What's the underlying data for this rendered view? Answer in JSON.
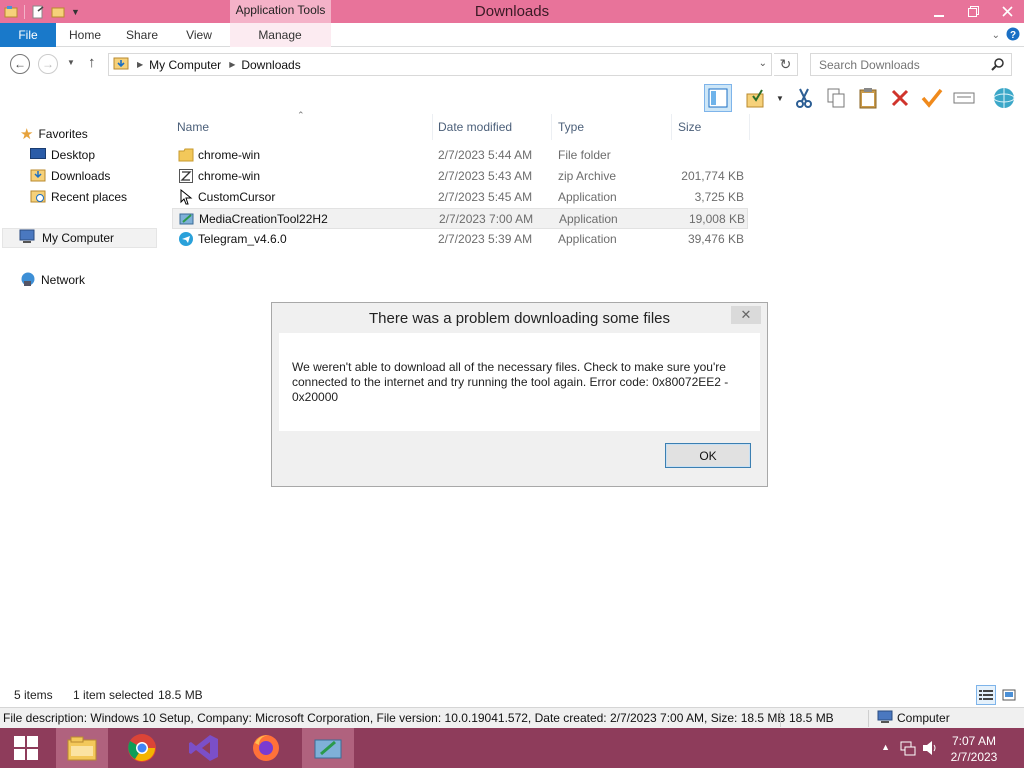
{
  "window": {
    "title": "Downloads",
    "context_tab": "Application Tools"
  },
  "ribbon": {
    "tabs": [
      "File",
      "Home",
      "Share",
      "View",
      "Manage"
    ]
  },
  "address": {
    "crumbs": [
      "My Computer",
      "Downloads"
    ],
    "search_placeholder": "Search Downloads"
  },
  "nav": {
    "favorites": "Favorites",
    "desktop": "Desktop",
    "downloads": "Downloads",
    "recent": "Recent places",
    "computer": "My Computer",
    "network": "Network"
  },
  "columns": {
    "name": "Name",
    "date": "Date modified",
    "type": "Type",
    "size": "Size"
  },
  "files": [
    {
      "name": "chrome-win",
      "date": "2/7/2023 5:44 AM",
      "type": "File folder",
      "size": "",
      "icon": "folder-icon"
    },
    {
      "name": "chrome-win",
      "date": "2/7/2023 5:43 AM",
      "type": "zip Archive",
      "size": "201,774 KB",
      "icon": "zip-icon"
    },
    {
      "name": "CustomCursor",
      "date": "2/7/2023 5:45 AM",
      "type": "Application",
      "size": "3,725 KB",
      "icon": "cursor-icon"
    },
    {
      "name": "MediaCreationTool22H2",
      "date": "2/7/2023 7:00 AM",
      "type": "Application",
      "size": "19,008 KB",
      "icon": "media-creation-icon"
    },
    {
      "name": "Telegram_v4.6.0",
      "date": "2/7/2023 5:39 AM",
      "type": "Application",
      "size": "39,476 KB",
      "icon": "telegram-icon"
    }
  ],
  "dialog": {
    "title": "There was a problem downloading some files",
    "message": "We weren't able to download all of the necessary files. Check to make sure you're connected to the internet and try running the tool again. Error code: 0x80072EE2 - 0x20000",
    "ok_label": "OK"
  },
  "status": {
    "items": "5 items",
    "selected": "1 item selected",
    "selected_size": "18.5 MB"
  },
  "infobar": {
    "description": "File description: Windows 10 Setup, Company: Microsoft Corporation, File version: 10.0.19041.572, Date created: 2/7/2023 7:00 AM, Size: 18.5 MB",
    "size": "18.5 MB",
    "location": "Computer"
  },
  "taskbar": {
    "time": "7:07 AM",
    "date": "2/7/2023"
  },
  "colors": {
    "titlebar": "#e8739a",
    "taskbar": "#8e3c5b",
    "file_tab": "#1979ca"
  }
}
